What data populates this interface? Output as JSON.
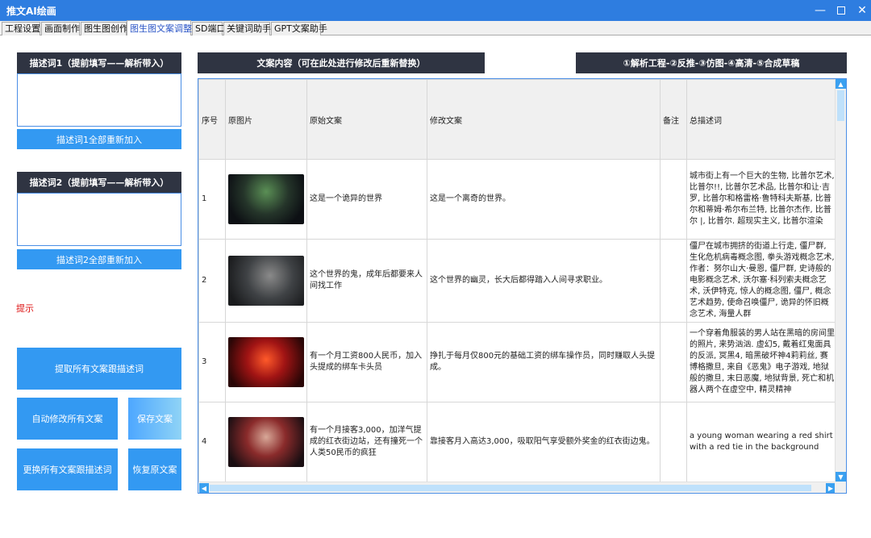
{
  "window": {
    "title": "推文AI绘画",
    "min_icon": "minimize-icon",
    "max_icon": "maximize-icon",
    "close_icon": "close-icon"
  },
  "tabs": [
    {
      "label": "工程设置"
    },
    {
      "label": "画面制作"
    },
    {
      "label": "图生图创作"
    },
    {
      "label": "图生图文案调整"
    },
    {
      "label": "SD端口"
    },
    {
      "label": "关键词助手"
    },
    {
      "label": "GPT文案助手"
    }
  ],
  "left_panel": {
    "desc1_header": "描述词1（提前填写——解析带入）",
    "desc1_value": "",
    "desc1_button": "描述词1全部重新加入",
    "desc2_header": "描述词2（提前填写——解析带入）",
    "desc2_value": "",
    "desc2_button": "描述词2全部重新加入",
    "hint": "提示",
    "extract_button": "提取所有文案跟描述词",
    "auto_modify_button": "自动修改所有文案",
    "save_button": "保存文案",
    "replace_button": "更换所有文案跟描述词",
    "restore_button": "恢复原文案"
  },
  "main": {
    "content_header": "文案内容（可在此处进行修改后重新替换）",
    "workflow_header": "①解析工程-②反推-③仿图-④高清-⑤合成草稿"
  },
  "table": {
    "columns": [
      "序号",
      "原图片",
      "原始文案",
      "修改文案",
      "备注",
      "总描述词"
    ],
    "rows": [
      {
        "index": "1",
        "thumb": "th1",
        "original": "这是一个诡异的世界",
        "modified": "这是一个离奇的世界。",
        "note": "",
        "desc": "城市街上有一个巨大的生物, 比普尔艺术, 比普尔!!, 比普尔艺术品, 比普尔和让·吉罗, 比普尔和格雷格·鲁特科夫斯基, 比普尔和蒂姆·希尔布兰特, 比普尔杰作, 比普尔 |, 比普尔. 超现实主义, 比普尔渲染"
      },
      {
        "index": "2",
        "thumb": "th2",
        "original": "这个世界的鬼，成年后都要来人间找工作",
        "modified": "这个世界的幽灵，长大后都得踏入人间寻求职业。",
        "note": "",
        "desc": "僵尸在城市拥挤的街道上行走, 僵尸群, 生化危机病毒概念图, 拳头游戏概念艺术, 作者：努尔山大·曼恩, 僵尸群, 史诗般的电影概念艺术, 沃尔塞·科列索夫概念艺术, 沃伊特克, 惊人的概念图, 僵尸, 概念艺术趋势, 使命召唤僵尸, 诡异的怀旧概念艺术, 海量人群"
      },
      {
        "index": "3",
        "thumb": "th3",
        "original": "有一个月工资800人民币，加入头提成的绑车卡头员",
        "modified": "挣扎于每月仅800元的基础工资的绑车操作员，同时赚取人头提成。",
        "note": "",
        "desc": "一个穿着角服装的男人站在黑暗的房间里的照片, 来势汹汹. 虚幻5, 戴着红鬼面具的反派, 冥黑4, 暗黑破坏神4莉莉丝, 赛博格撒旦, 来自《恶鬼》电子游戏, 地狱般的撒旦, 末日恶魔, 地狱背景, 死亡和机器人两个在虚空中, 精灵精神"
      },
      {
        "index": "4",
        "thumb": "th4",
        "original": "有一个月接客3,000，加洋气提成的红衣街边站，还有撞死一个人类50民币的疯狂",
        "modified": "靠接客月入高达3,000，吸取阳气享受额外奖金的红衣街边鬼。",
        "note": "",
        "desc": "a young woman wearing a red shirt with a red tie in the background"
      }
    ]
  }
}
